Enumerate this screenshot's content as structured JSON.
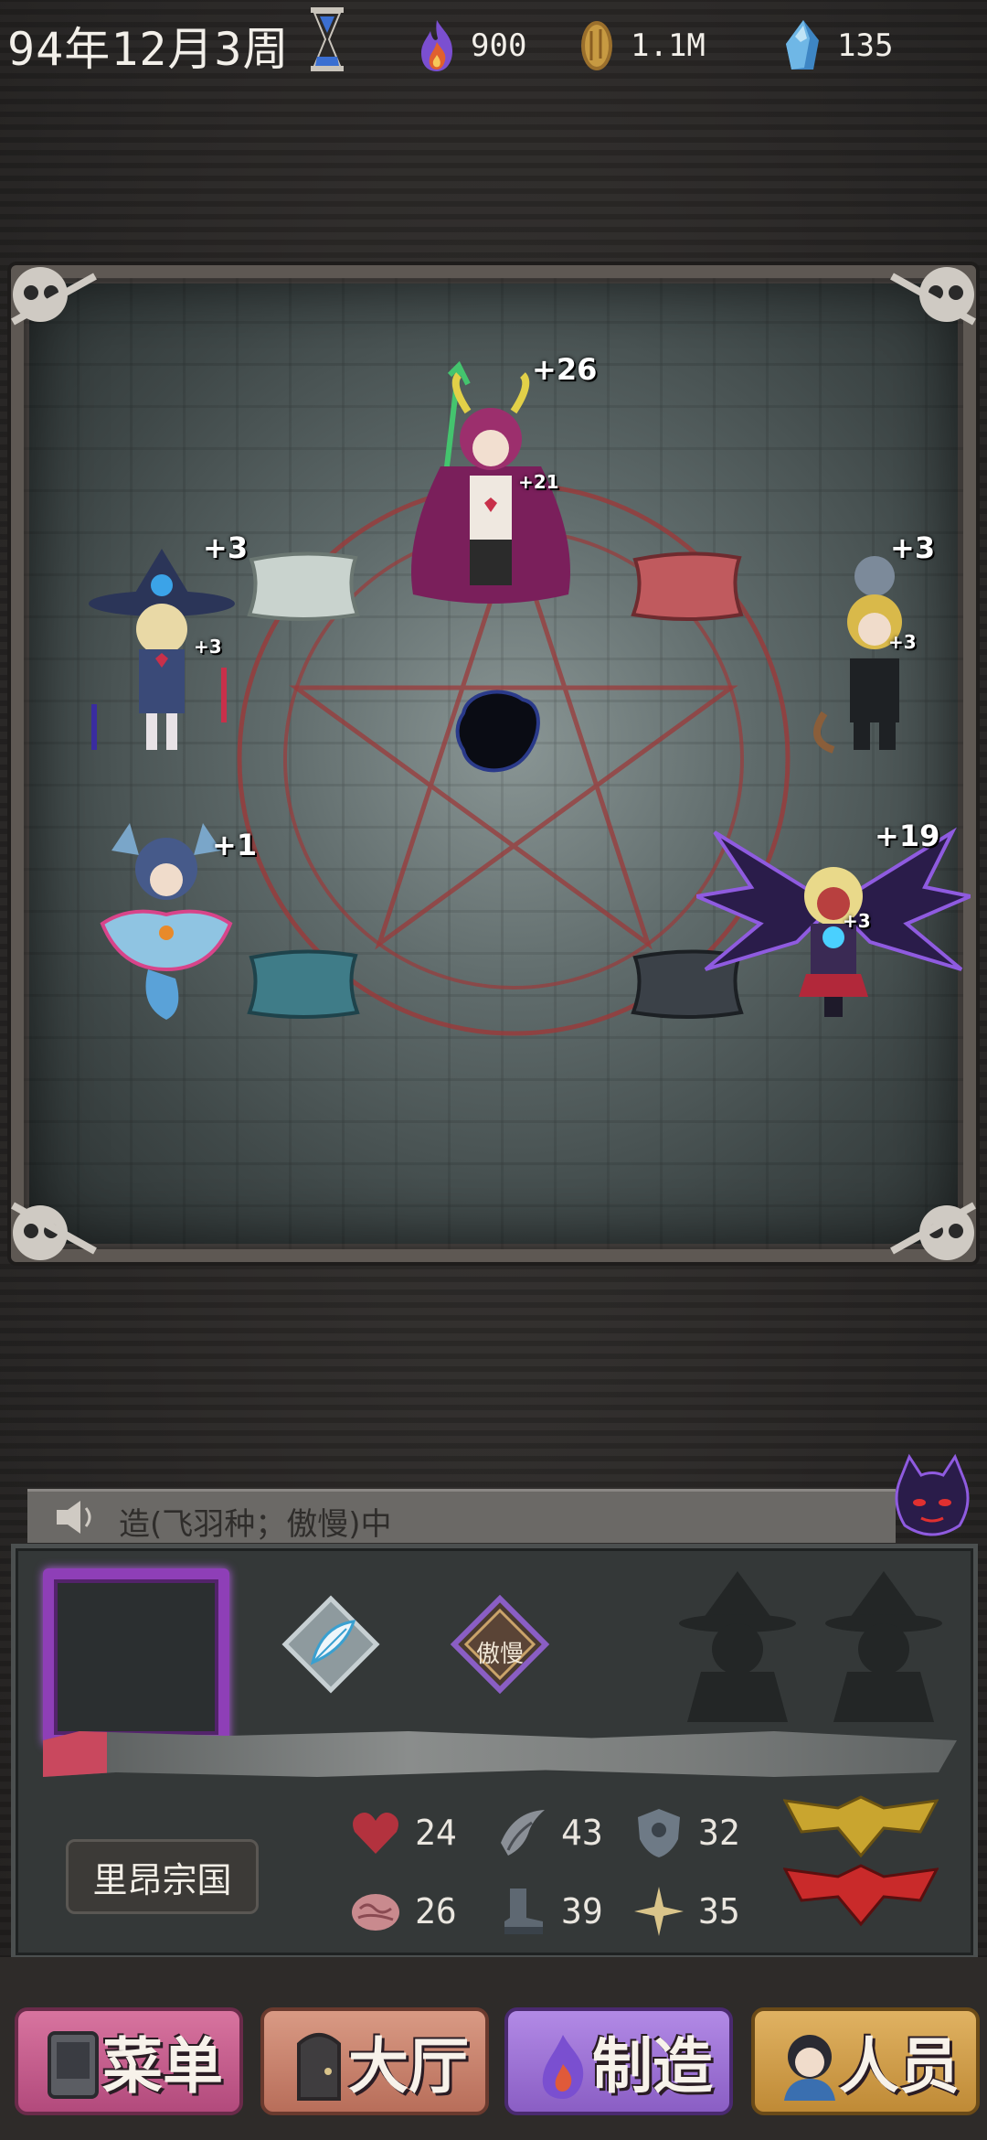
{
  "topbar": {
    "date": "94年12月3周",
    "resources": [
      {
        "icon": "flame-icon",
        "value": "900",
        "color": "#8b5bd6"
      },
      {
        "icon": "coin-icon",
        "value": "1.1M",
        "color": "#c79a42"
      },
      {
        "icon": "crystal-icon",
        "value": "135",
        "color": "#4aa0d8"
      }
    ]
  },
  "arena": {
    "units": [
      {
        "name": "witch-girl",
        "bonus": "+3",
        "small_bonus": "+3"
      },
      {
        "name": "horned-mage",
        "bonus": "+26",
        "small_bonus": "+21"
      },
      {
        "name": "suited-boy",
        "bonus": "+3",
        "small_bonus": "+3"
      },
      {
        "name": "ghost-maiden",
        "bonus": "+1"
      },
      {
        "name": "winged-demon",
        "bonus": "+19",
        "small_bonus": "+3"
      }
    ]
  },
  "chat": {
    "text": "造(飞羽种；傲慢)中"
  },
  "panel": {
    "trait_badge": "傲慢",
    "country": "里昂宗国",
    "progress": 0.07,
    "stats": [
      {
        "icon": "heart-icon",
        "value": "24"
      },
      {
        "icon": "claw-icon",
        "value": "43"
      },
      {
        "icon": "shield-icon",
        "value": "32"
      },
      {
        "icon": "brain-icon",
        "value": "26"
      },
      {
        "icon": "boot-icon",
        "value": "39"
      },
      {
        "icon": "sparkle-icon",
        "value": "35"
      }
    ]
  },
  "nav": {
    "items": [
      {
        "label": "菜单",
        "icon": "phone-icon",
        "color": "#c95f8e"
      },
      {
        "label": "大厅",
        "icon": "door-icon",
        "color": "#c98470"
      },
      {
        "label": "制造",
        "icon": "craft-icon",
        "color": "#9a6fd6"
      },
      {
        "label": "人员",
        "icon": "person-icon",
        "color": "#cf9a47"
      }
    ]
  }
}
